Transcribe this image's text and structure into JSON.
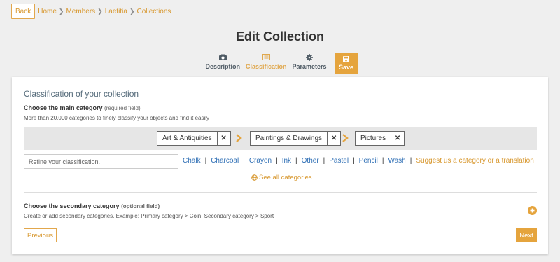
{
  "nav": {
    "back_label": "Back",
    "breadcrumbs": [
      "Home",
      "Members",
      "Laetitia",
      "Collections"
    ]
  },
  "page_title": "Edit Collection",
  "steps": [
    {
      "label": "Description",
      "icon": "camera-icon",
      "active": false
    },
    {
      "label": "Classification",
      "icon": "list-icon",
      "active": true
    },
    {
      "label": "Parameters",
      "icon": "gear-icon",
      "active": false
    }
  ],
  "save_label": "Save",
  "classification": {
    "section_title": "Classification of your collection",
    "main_label": "Choose the main category",
    "main_required": "(required field)",
    "main_description": "More than 20,000 categories to finely classify your objects and find it easily",
    "selected_path": [
      "Art & Antiquities",
      "Paintings & Drawings",
      "Pictures"
    ],
    "refine_placeholder": "Refine your classification.",
    "subcategories": [
      "Chalk",
      "Charcoal",
      "Crayon",
      "Ink",
      "Other",
      "Pastel",
      "Pencil",
      "Wash"
    ],
    "suggest_label": "Suggest us a category or a translation",
    "see_all_label": "See all categories",
    "secondary_label": "Choose the secondary category",
    "secondary_optional": "(optional field)",
    "secondary_description": "Create or add secondary categories. Example: Primary category > Coin, Secondary category > Sport"
  },
  "footer": {
    "previous_label": "Previous",
    "next_label": "Next"
  },
  "colors": {
    "accent": "#e5a43d",
    "link_blue": "#2f6fb5",
    "background": "#efefef"
  }
}
